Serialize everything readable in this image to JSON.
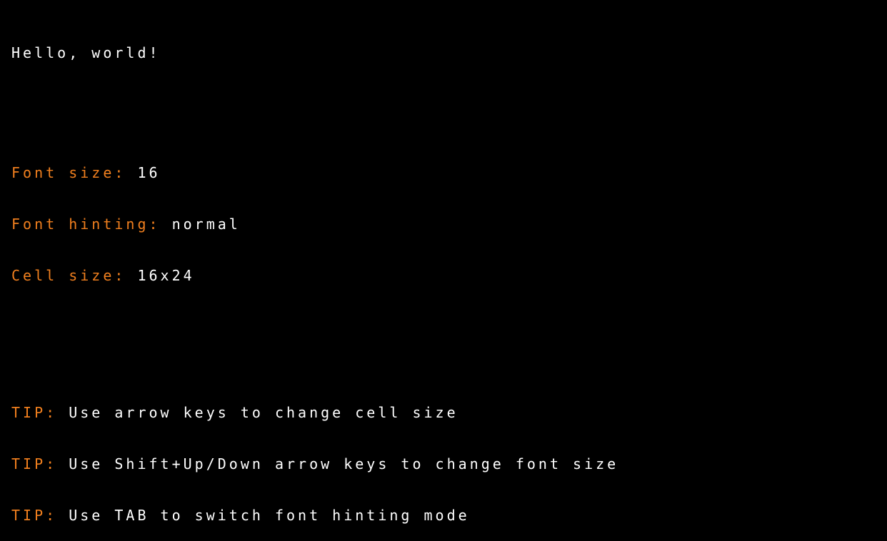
{
  "greeting": "Hello, world!",
  "settings": [
    {
      "label": "Font size: ",
      "value": "16"
    },
    {
      "label": "Font hinting: ",
      "value": "normal"
    },
    {
      "label": "Cell size: ",
      "value": "16x24"
    }
  ],
  "tips": [
    {
      "label": "TIP: ",
      "text": "Use arrow keys to change cell size"
    },
    {
      "label": "TIP: ",
      "text": "Use Shift+Up/Down arrow keys to change font size"
    },
    {
      "label": "TIP: ",
      "text": "Use TAB to switch font hinting mode"
    }
  ],
  "colors": {
    "background": "#000000",
    "text": "#ffffff",
    "accent": "#f07f1e"
  }
}
